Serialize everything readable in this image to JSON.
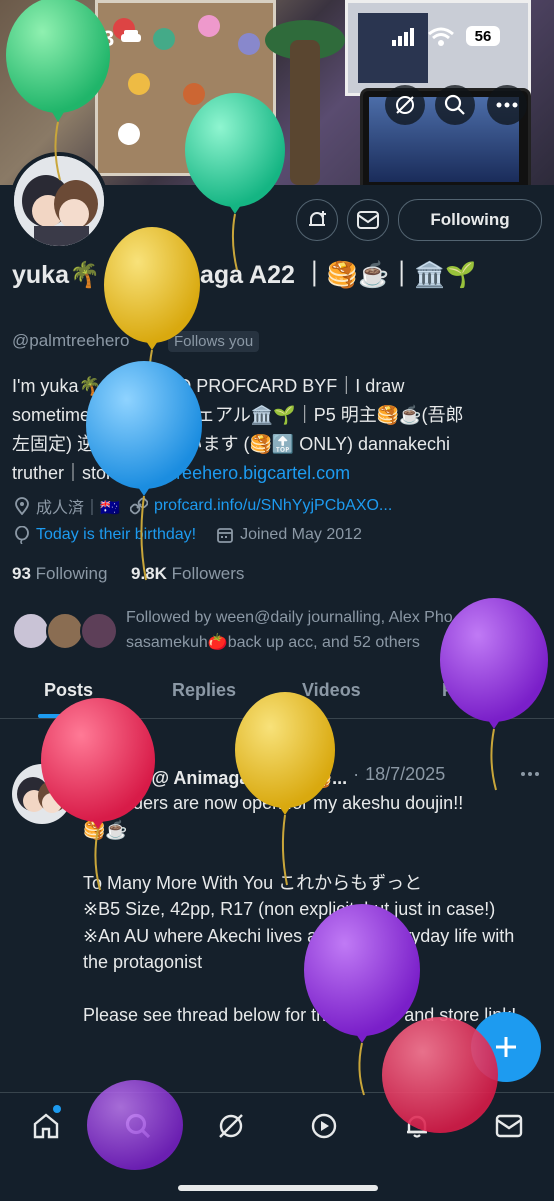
{
  "status_bar": {
    "time": "12:03",
    "battery": "56"
  },
  "profile": {
    "display_name": "yuka🌴 @ Animaga A22 ｜🥞☕️｜🏛️🌱",
    "handle": "@palmtreehero",
    "follows_you": "Follows you",
    "bio_line1": "I'm yuka🌴｜⚠️READ PROFCARD BYF｜I draw",
    "bio_line2": "sometimes｜ghsn カヴェアル🏛️🌱｜P5 明主🥞☕️(吾郎",
    "bio_line3": "左固定) 逆は自衛しています (🥞🔝 ONLY) dannakechi",
    "bio_line4_prefix": "truther｜store: ",
    "store_link": "palmtreehero.bigcartel.com",
    "location": "成人済｜🇦🇺",
    "website": "profcard.info/u/SNhYyjPCbAXO...",
    "birthday": "Today is their birthday!",
    "joined": "Joined May 2012",
    "following_count": "93",
    "following_label": "Following",
    "followers_count": "9.8K",
    "followers_label": "Followers",
    "followed_by": "Followed by ween@daily journalling, Alex Pho, sasamekuh🍅back up acc, and 52 others",
    "following_button": "Following"
  },
  "tabs": [
    "Posts",
    "Replies",
    "Videos",
    "Photos"
  ],
  "pinned_post": {
    "pinned_label": "Pinned",
    "author": "yuka🌴 @ Animaga A22 ｜🥞...",
    "date": "18/7/2025",
    "text": "Pre-orders are now open for my akeshu doujin!!\n🥞☕️\n\nTo Many More With You これからもずっと\n※B5 Size, 42pp, R17 (non explicit, but just in case!)\n※An AU where Akechi lives a happy everyday life with the protagonist\n\nPlease see thread below for the sample and store link!"
  },
  "colors": {
    "accent": "#1d9bf0",
    "background": "#15202b"
  }
}
